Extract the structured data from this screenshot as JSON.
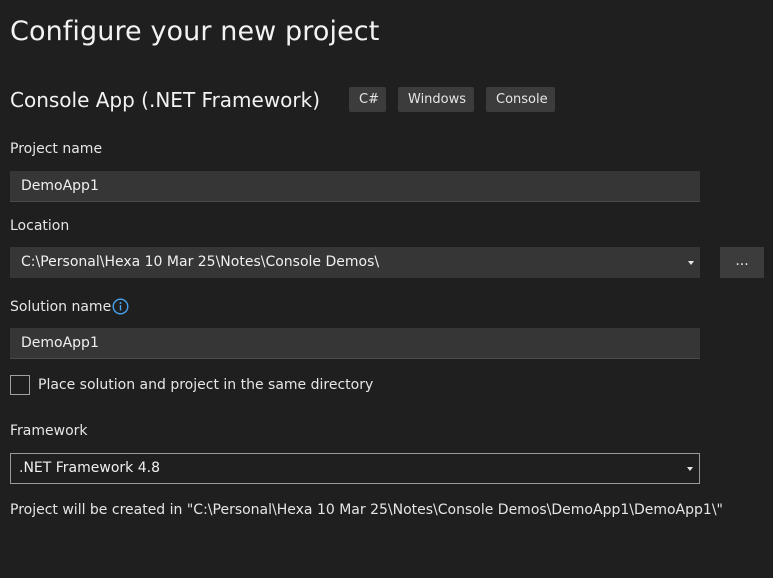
{
  "page": {
    "title": "Configure your new project"
  },
  "template": {
    "name": "Console App (.NET Framework)",
    "tags": [
      "C#",
      "Windows",
      "Console"
    ]
  },
  "project_name": {
    "label": "Project name",
    "value": "DemoApp1"
  },
  "location": {
    "label": "Location",
    "value": "C:\\Personal\\Hexa 10 Mar 25\\Notes\\Console Demos\\",
    "browse_label": "..."
  },
  "solution_name": {
    "label": "Solution name",
    "value": "DemoApp1",
    "icon": "info-icon"
  },
  "same_directory": {
    "label": "Place solution and project in the same directory",
    "checked": false
  },
  "framework": {
    "label": "Framework",
    "value": ".NET Framework 4.8"
  },
  "footer": {
    "note": "Project will be created in \"C:\\Personal\\Hexa 10 Mar 25\\Notes\\Console Demos\\DemoApp1\\DemoApp1\\\""
  },
  "colors": {
    "background": "#1f1f1f",
    "field": "#363636",
    "tag": "#3c3c3c",
    "accent": "#4aa3f0"
  }
}
